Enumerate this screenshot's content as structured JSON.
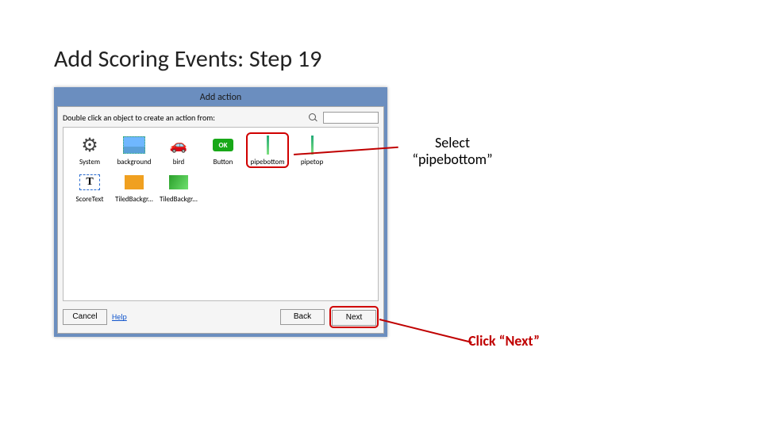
{
  "slide": {
    "title": "Add Scoring Events: Step 19"
  },
  "dialog": {
    "title": "Add action",
    "instruction": "Double click an object to create an action from:",
    "search_placeholder": ""
  },
  "objects": {
    "system": "System",
    "background": "background",
    "bird": "bird",
    "button": "Button",
    "pipebottom": "pipebottom",
    "pipetop": "pipetop",
    "scoretext": "ScoreText",
    "tiled1": "TiledBackgr...",
    "tiled2": "TiledBackgr..."
  },
  "footer": {
    "cancel": "Cancel",
    "help": "Help",
    "back": "Back",
    "next": "Next"
  },
  "callouts": {
    "select": "Select “pipebottom”",
    "clicknext": "Click “Next”"
  },
  "icons": {
    "ok": "OK",
    "T": "T"
  }
}
